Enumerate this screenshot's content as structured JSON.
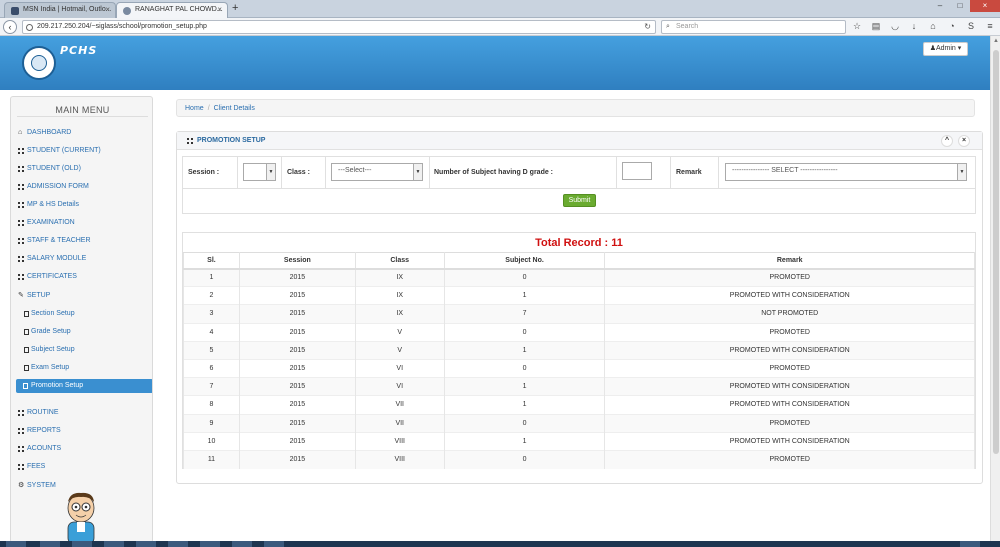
{
  "browser": {
    "tabs": [
      {
        "label": "MSN India | Hotmail, Outlo..."
      },
      {
        "label": "RANAGHAT PAL CHOWD..."
      }
    ],
    "url": "209.217.250.204/~siglass/school/promotion_setup.php",
    "search_placeholder": "Search"
  },
  "header": {
    "brand": "PCHS",
    "admin_label": "Admin"
  },
  "sidebar": {
    "title": "MAIN MENU",
    "items": [
      {
        "label": "DASHBOARD",
        "icon": "home-icon"
      },
      {
        "label": "STUDENT (CURRENT)",
        "icon": "grid-icon"
      },
      {
        "label": "STUDENT (OLD)",
        "icon": "grid-icon"
      },
      {
        "label": "ADMISSION FORM",
        "icon": "grid-icon"
      },
      {
        "label": "MP & HS Details",
        "icon": "grid-icon"
      },
      {
        "label": "EXAMINATION",
        "icon": "grid-icon"
      },
      {
        "label": "STAFF & TEACHER",
        "icon": "grid-icon"
      },
      {
        "label": "SALARY MODULE",
        "icon": "grid-icon"
      },
      {
        "label": "CERTIFICATES",
        "icon": "grid-icon"
      },
      {
        "label": "SETUP",
        "icon": "wrench-icon"
      },
      {
        "label": "Section Setup",
        "icon": "list-icon"
      },
      {
        "label": "Grade Setup",
        "icon": "list-icon"
      },
      {
        "label": "Subject Setup",
        "icon": "list-icon"
      },
      {
        "label": "Exam Setup",
        "icon": "list-icon"
      },
      {
        "label": "Promotion Setup",
        "icon": "list-icon"
      },
      {
        "label": "ROUTINE",
        "icon": "grid-icon"
      },
      {
        "label": "REPORTS",
        "icon": "grid-icon"
      },
      {
        "label": "ACOUNTS",
        "icon": "grid-icon"
      },
      {
        "label": "FEES",
        "icon": "grid-icon"
      },
      {
        "label": "SYSTEM",
        "icon": "gears-icon"
      }
    ]
  },
  "breadcrumb": {
    "home": "Home",
    "sep": "/",
    "current": "Client Details"
  },
  "panel": {
    "title": "PROMOTION SETUP",
    "collapse_icon": "^",
    "close_icon": "×"
  },
  "form": {
    "session_label": "Session :",
    "class_label": "Class :",
    "class_value": "---Select---",
    "subject_label": "Number of Subject having D grade :",
    "remark_label": "Remark",
    "remark_value": "---------------- SELECT ----------------",
    "submit_label": "Submit"
  },
  "results": {
    "total": "Total Record : 11",
    "columns": [
      "Sl.",
      "Session",
      "Class",
      "Subject No.",
      "Remark"
    ],
    "rows": [
      [
        "1",
        "2015",
        "IX",
        "0",
        "PROMOTED"
      ],
      [
        "2",
        "2015",
        "IX",
        "1",
        "PROMOTED WITH CONSIDERATION"
      ],
      [
        "3",
        "2015",
        "IX",
        "7",
        "NOT PROMOTED"
      ],
      [
        "4",
        "2015",
        "V",
        "0",
        "PROMOTED"
      ],
      [
        "5",
        "2015",
        "V",
        "1",
        "PROMOTED WITH CONSIDERATION"
      ],
      [
        "6",
        "2015",
        "VI",
        "0",
        "PROMOTED"
      ],
      [
        "7",
        "2015",
        "VI",
        "1",
        "PROMOTED WITH CONSIDERATION"
      ],
      [
        "8",
        "2015",
        "VII",
        "1",
        "PROMOTED WITH CONSIDERATION"
      ],
      [
        "9",
        "2015",
        "VII",
        "0",
        "PROMOTED"
      ],
      [
        "10",
        "2015",
        "VIII",
        "1",
        "PROMOTED WITH CONSIDERATION"
      ],
      [
        "11",
        "2015",
        "VIII",
        "0",
        "PROMOTED"
      ]
    ]
  }
}
